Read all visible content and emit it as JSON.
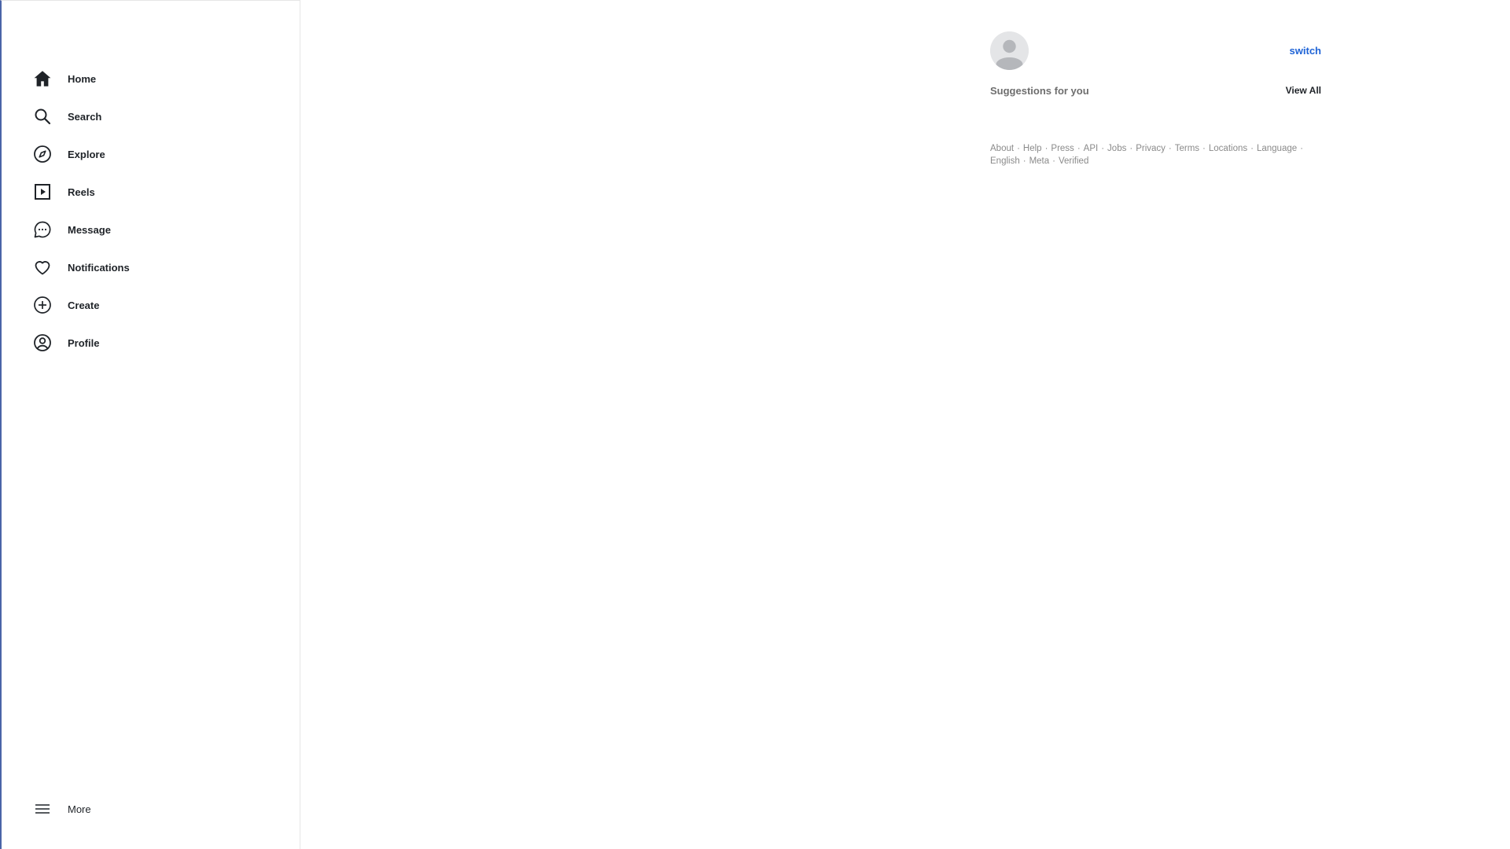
{
  "sidebar": {
    "items": [
      {
        "label": "Home",
        "icon": "home-icon"
      },
      {
        "label": "Search",
        "icon": "search-icon"
      },
      {
        "label": "Explore",
        "icon": "compass-icon"
      },
      {
        "label": "Reels",
        "icon": "play-square-icon"
      },
      {
        "label": "Message",
        "icon": "chat-bubble-icon"
      },
      {
        "label": "Notifications",
        "icon": "heart-icon"
      },
      {
        "label": "Create",
        "icon": "plus-circle-icon"
      },
      {
        "label": "Profile",
        "icon": "user-circle-icon"
      }
    ],
    "more": {
      "label": "More",
      "icon": "menu-icon"
    }
  },
  "right_panel": {
    "avatar_icon": "default-avatar-icon",
    "switch_label": "switch",
    "suggestions_title": "Suggestions for you",
    "view_all_label": "View All",
    "footer_links": [
      "About",
      "Help",
      "Press",
      "API",
      "Jobs",
      "Privacy",
      "Terms",
      "Locations",
      "Language",
      "English",
      "Meta",
      "Verified"
    ],
    "footer_separator": "·"
  },
  "colors": {
    "link_blue": "#1e63d6",
    "text_dark": "#1f2328",
    "text_muted": "#6e6e6e",
    "footer_gray": "#8a8a8a",
    "avatar_bg": "#e4e5e7"
  }
}
